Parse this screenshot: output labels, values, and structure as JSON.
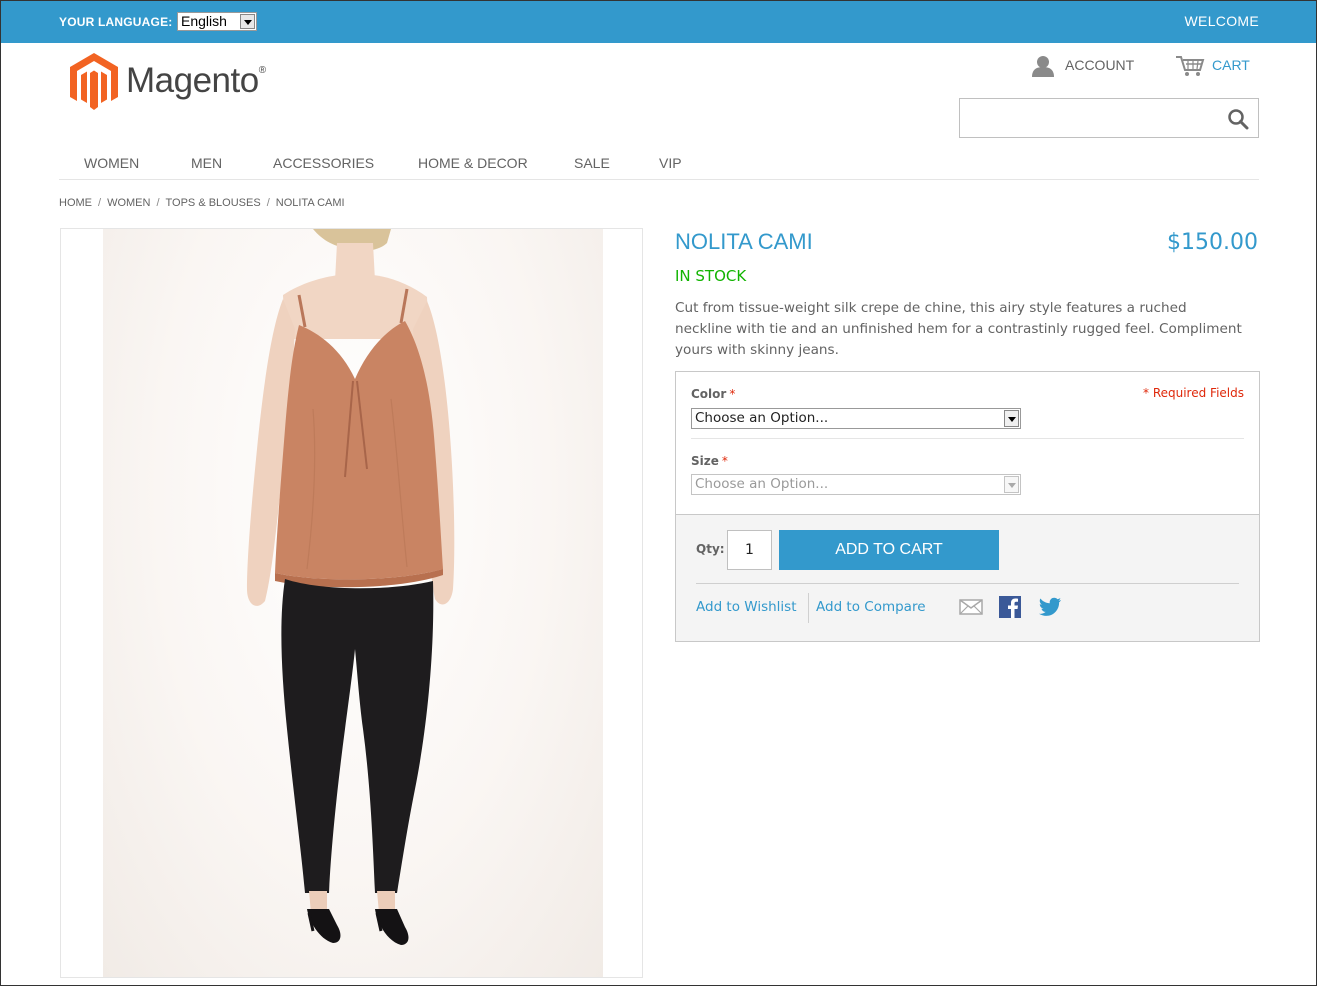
{
  "header": {
    "language_label": "YOUR LANGUAGE:",
    "language_value": "English",
    "welcome": "WELCOME",
    "account_label": "ACCOUNT",
    "cart_label": "CART",
    "logo_text": "Magento",
    "logo_mark": "®",
    "search_value": ""
  },
  "nav": {
    "items": [
      "WOMEN",
      "MEN",
      "ACCESSORIES",
      "HOME & DECOR",
      "SALE",
      "VIP"
    ]
  },
  "breadcrumb": {
    "items": [
      "HOME",
      "WOMEN",
      "TOPS & BLOUSES",
      "NOLITA CAMI"
    ],
    "separator": "/"
  },
  "product": {
    "name": "NOLITA CAMI",
    "price": "$150.00",
    "stock": "IN STOCK",
    "description": "Cut from tissue-weight silk crepe de chine, this airy style features a ruched neckline with tie and an unfinished hem for a contrastinly rugged feel. Compliment yours with skinny jeans."
  },
  "options": {
    "required_note": "* Required Fields",
    "color_label": "Color",
    "color_value": "Choose an Option...",
    "size_label": "Size",
    "size_value": "Choose an Option...",
    "required_marker": "*"
  },
  "cart_box": {
    "qty_label": "Qty:",
    "qty_value": "1",
    "add_to_cart": "ADD TO CART",
    "wishlist": "Add to Wishlist",
    "compare": "Add to Compare"
  },
  "colors": {
    "accent": "#3399cc",
    "in_stock": "#11b400",
    "required": "#df280a",
    "logo_orange": "#f26322"
  },
  "icons": [
    "account-icon",
    "cart-icon",
    "search-icon",
    "email-icon",
    "facebook-icon",
    "twitter-icon"
  ]
}
